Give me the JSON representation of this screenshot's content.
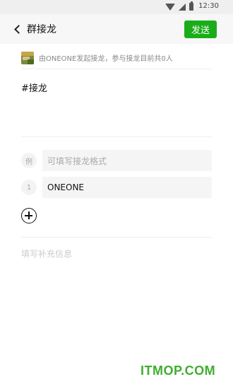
{
  "status_bar": {
    "time": "12:30",
    "icons": [
      "wifi-icon",
      "signal-icon",
      "battery-icon"
    ]
  },
  "nav": {
    "title": "群接龙",
    "send_label": "发送",
    "accent_color": "#1aad19"
  },
  "initiator": {
    "text": "由ONEONE发起接龙，参与接龙目前共0人"
  },
  "topic": "#接龙",
  "entries": [
    {
      "index_label": "例",
      "value": "",
      "placeholder": "可填写接龙格式"
    },
    {
      "index_label": "1",
      "value": "ONEONE",
      "placeholder": ""
    }
  ],
  "extra_info_placeholder": "填写补充信息",
  "watermark": "ITMOP.COM"
}
